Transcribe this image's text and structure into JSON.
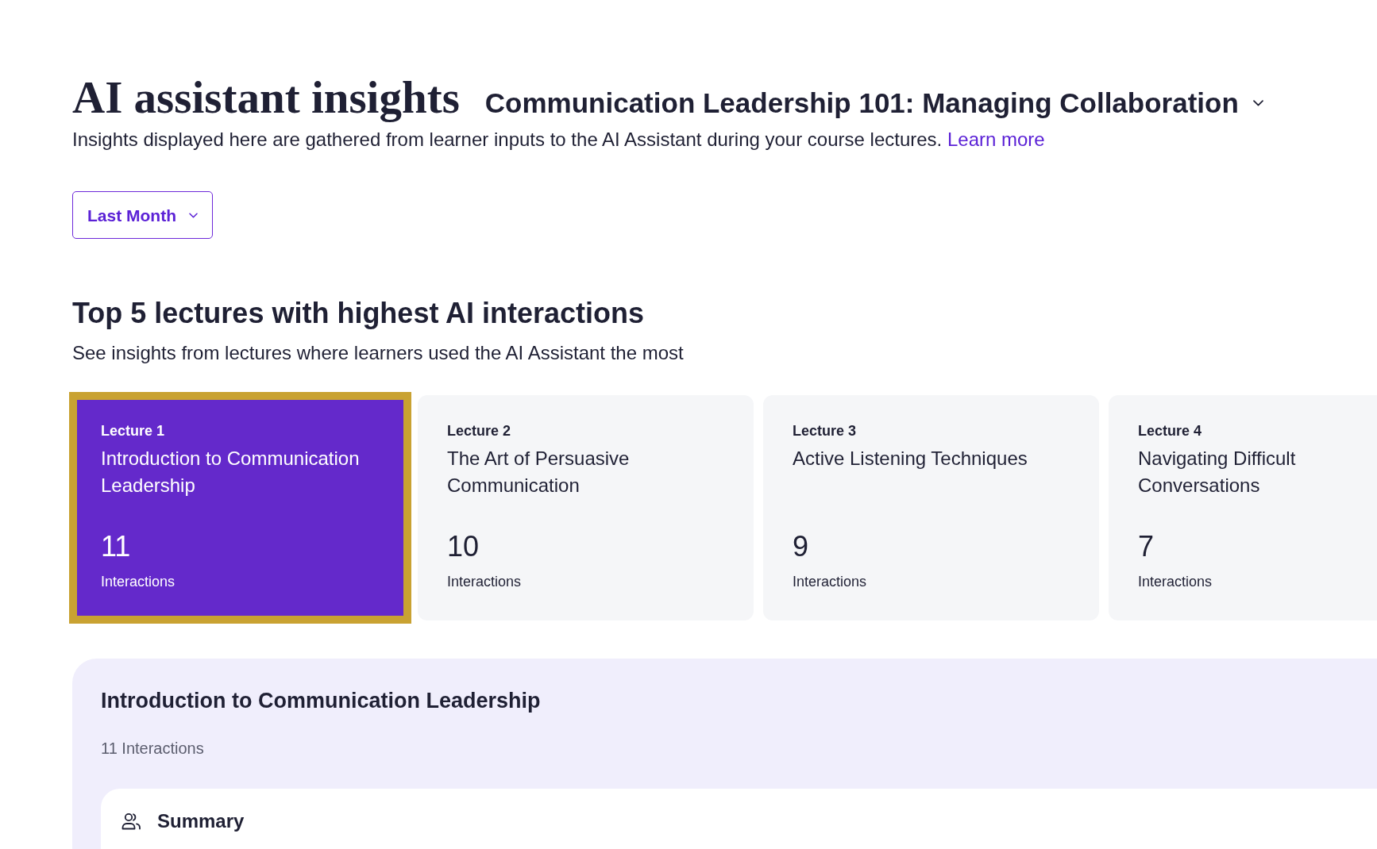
{
  "header": {
    "title": "AI assistant insights",
    "course_selector": {
      "label": "Communication Leadership 101: Managing Collaboration"
    },
    "description": "Insights displayed here are gathered from learner inputs to the AI Assistant during your course lectures.",
    "learn_more_link": "Learn more"
  },
  "period_filter": {
    "label": "Last Month"
  },
  "top_lectures": {
    "heading": "Top 5 lectures with highest AI interactions",
    "subheading": "See insights from lectures where learners used the AI Assistant the most",
    "cards": [
      {
        "lecture": "Lecture 1",
        "title": "Introduction to Communication Leadership",
        "count": "11",
        "count_label": "Interactions",
        "selected": true
      },
      {
        "lecture": "Lecture 2",
        "title": "The Art of Persuasive Communication",
        "count": "10",
        "count_label": "Interactions",
        "selected": false
      },
      {
        "lecture": "Lecture 3",
        "title": "Active Listening Techniques",
        "count": "9",
        "count_label": "Interactions",
        "selected": false
      },
      {
        "lecture": "Lecture 4",
        "title": "Navigating Difficult Conversations",
        "count": "7",
        "count_label": "Interactions",
        "selected": false
      }
    ]
  },
  "detail_panel": {
    "title": "Introduction to Communication Leadership",
    "interactions": "11 Interactions",
    "summary": {
      "title": "Summary"
    }
  }
}
